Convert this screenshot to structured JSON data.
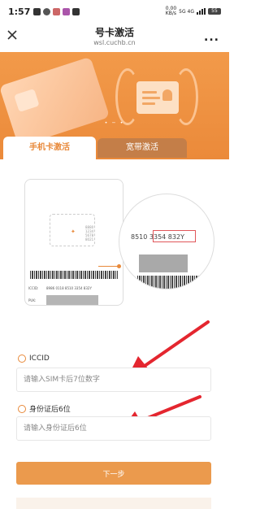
{
  "status_bar": {
    "time": "1:57",
    "net_speed": "0.00\nKB/s",
    "network": "5G 4G",
    "battery": "55"
  },
  "nav": {
    "title": "号卡激活",
    "domain": "wsl.cuchb.cn",
    "more_label": "..."
  },
  "tabs": [
    {
      "label": "手机卡激活",
      "active": true
    },
    {
      "label": "宽带激活",
      "active": false
    }
  ],
  "illustration": {
    "iccid_label": "ICCID:",
    "iccid_number": "8986 0118 8510 3354 832Y",
    "puk_label": "PUK:",
    "zoom_number": "8510  3354  832Y"
  },
  "form": {
    "iccid": {
      "label": "ICCID",
      "placeholder": "请输入SIM卡后7位数字"
    },
    "id_card": {
      "label": "身份证后6位",
      "placeholder": "请输入身份证后6位"
    },
    "submit_label": "下一步"
  },
  "colors": {
    "accent": "#e8893a",
    "banner": "#ec8e3f",
    "arrow": "#e4262f"
  }
}
